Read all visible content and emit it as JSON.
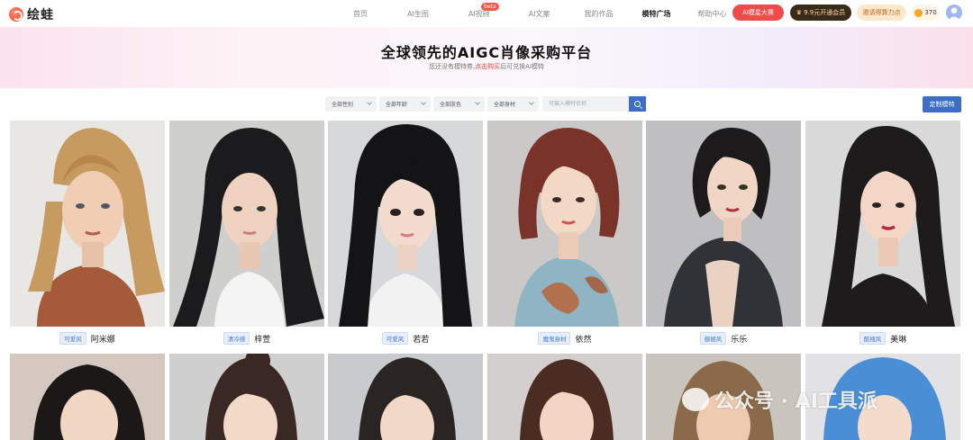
{
  "brand": {
    "logo_text": "绘蛙"
  },
  "nav": {
    "items": [
      {
        "label": "首页",
        "active": false
      },
      {
        "label": "AI生图",
        "active": false
      },
      {
        "label": "AI视频",
        "active": false,
        "badge": "beta"
      },
      {
        "label": "AI文案",
        "active": false
      },
      {
        "label": "我的作品",
        "active": false
      },
      {
        "label": "模特广场",
        "active": true
      },
      {
        "label": "帮助中心",
        "active": false
      }
    ],
    "contest_label": "AI模星大赛",
    "member_label": "9.9元开通会员",
    "invite_label": "邀请得算力点",
    "points": "370"
  },
  "hero": {
    "title": "全球领先的AIGC肖像采购平台",
    "subtitle_pre": "您还没有模特券,",
    "subtitle_link": "点击购买",
    "subtitle_post": "后可兑换AI模特"
  },
  "filters": {
    "gender": "全部性别",
    "age": "全部年龄",
    "skin": "全部肤色",
    "body": "全部身材",
    "search_placeholder": "可输入模特名称",
    "custom_button": "定制模特"
  },
  "models": [
    {
      "tag": "可爱风",
      "name": "阿米娜"
    },
    {
      "tag": "清冷感",
      "name": "梓萱"
    },
    {
      "tag": "可爱风",
      "name": "若若"
    },
    {
      "tag": "魔鬼身材",
      "name": "依然"
    },
    {
      "tag": "御姐风",
      "name": "乐乐"
    },
    {
      "tag": "酷拽风",
      "name": "美琳"
    }
  ],
  "watermark": "公众号 · AI工具派",
  "colors": {
    "accent": "#3d6dc5",
    "red": "#ef4b4b"
  }
}
